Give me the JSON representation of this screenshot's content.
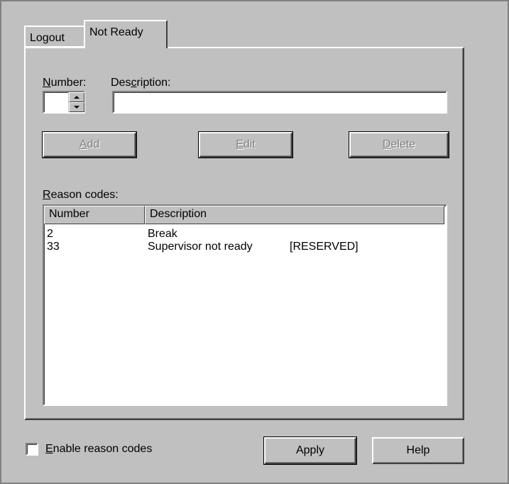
{
  "tabs": [
    {
      "label": "Logout"
    },
    {
      "label": "Not Ready"
    }
  ],
  "form": {
    "number_label_prefix": "",
    "number_label_accel": "N",
    "number_label_rest": "umber:",
    "number_value": "",
    "description_label_prefix": "Des",
    "description_label_accel": "c",
    "description_label_rest": "ription:",
    "description_value": ""
  },
  "buttons": {
    "add_accel": "A",
    "add_rest": "dd",
    "edit_accel": "E",
    "edit_rest": "dit",
    "delete_accel": "D",
    "delete_rest": "elete",
    "apply": "Apply",
    "help": "Help"
  },
  "reason_codes": {
    "label_accel": "R",
    "label_rest": "eason codes:",
    "columns": [
      "Number",
      "Description"
    ],
    "rows": [
      {
        "number": "2",
        "description": "Break",
        "note": ""
      },
      {
        "number": "33",
        "description": "Supervisor not ready",
        "note": "[RESERVED]"
      }
    ]
  },
  "enable": {
    "accel": "E",
    "rest": "nable reason codes",
    "checked": false
  }
}
